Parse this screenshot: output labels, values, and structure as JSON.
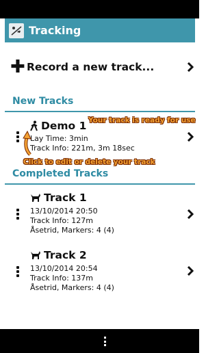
{
  "app": {
    "title": "Tracking",
    "icon": "app-track-icon"
  },
  "record": {
    "label": "Record a new track...",
    "icon": "plus-icon"
  },
  "sections": {
    "new": "New Tracks",
    "completed": "Completed Tracks"
  },
  "new_tracks": [
    {
      "title": "Demo 1",
      "icon": "person-icon",
      "line1": "Lay Time: 3min",
      "line2": "Track Info: 221m, 3m 18sec"
    }
  ],
  "completed_tracks": [
    {
      "title": "Track 1",
      "icon": "dog-icon",
      "line1": "13/10/2014 20:50",
      "line2": "Track Info: 127m",
      "line3": "Åsetrid, Markers: 4 (4)"
    },
    {
      "title": "Track 2",
      "icon": "dog-icon",
      "line1": "13/10/2014 20:54",
      "line2": "Track Info: 137m",
      "line3": "Åsetrid, Markers: 4 (4)"
    }
  ],
  "annotations": {
    "ready": "Your track is ready for use",
    "edit": "Click to edit or delete your track"
  },
  "colors": {
    "accent": "#3f96ab",
    "annotation": "#f4a234"
  }
}
